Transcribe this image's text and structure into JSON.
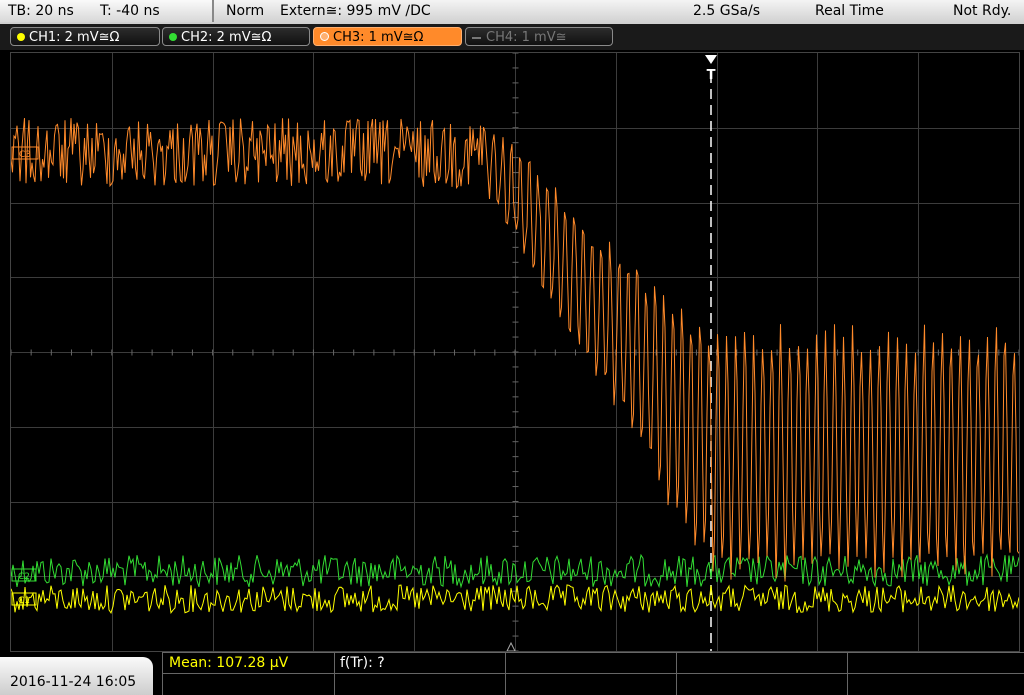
{
  "statusbar": {
    "timebase": "TB: 20 ns",
    "trigger_time": "T: -40 ns",
    "trigger_mode": "Norm",
    "trigger_source": "Extern≅: 995 mV ∕DC",
    "sample_rate": "2.5 GSa/s",
    "acq_mode": "Real Time",
    "status": "Not Rdy."
  },
  "channels": [
    {
      "label": "CH1: 2 mV≅Ω",
      "color": "#ffff00",
      "state": "on"
    },
    {
      "label": "CH2: 2 mV≅Ω",
      "color": "#33dd33",
      "state": "on"
    },
    {
      "label": "CH3: 1 mV≅Ω",
      "color": "#ff8a2a",
      "state": "active"
    },
    {
      "label": "CH4: 1 mV≅",
      "color": "#777777",
      "state": "off"
    }
  ],
  "markers": {
    "trigger": "T",
    "ch3": "C3",
    "ch2": "C2",
    "ch1": "C1"
  },
  "measurements": {
    "mean": "Mean: 107.28 µV",
    "freq": "f(Tr): ?"
  },
  "datetime": "2016-11-24 16:05",
  "colors": {
    "ch1": "#ffff00",
    "ch2": "#33dd33",
    "ch3": "#ff8a2a",
    "grid": "#3c3c3c"
  }
}
